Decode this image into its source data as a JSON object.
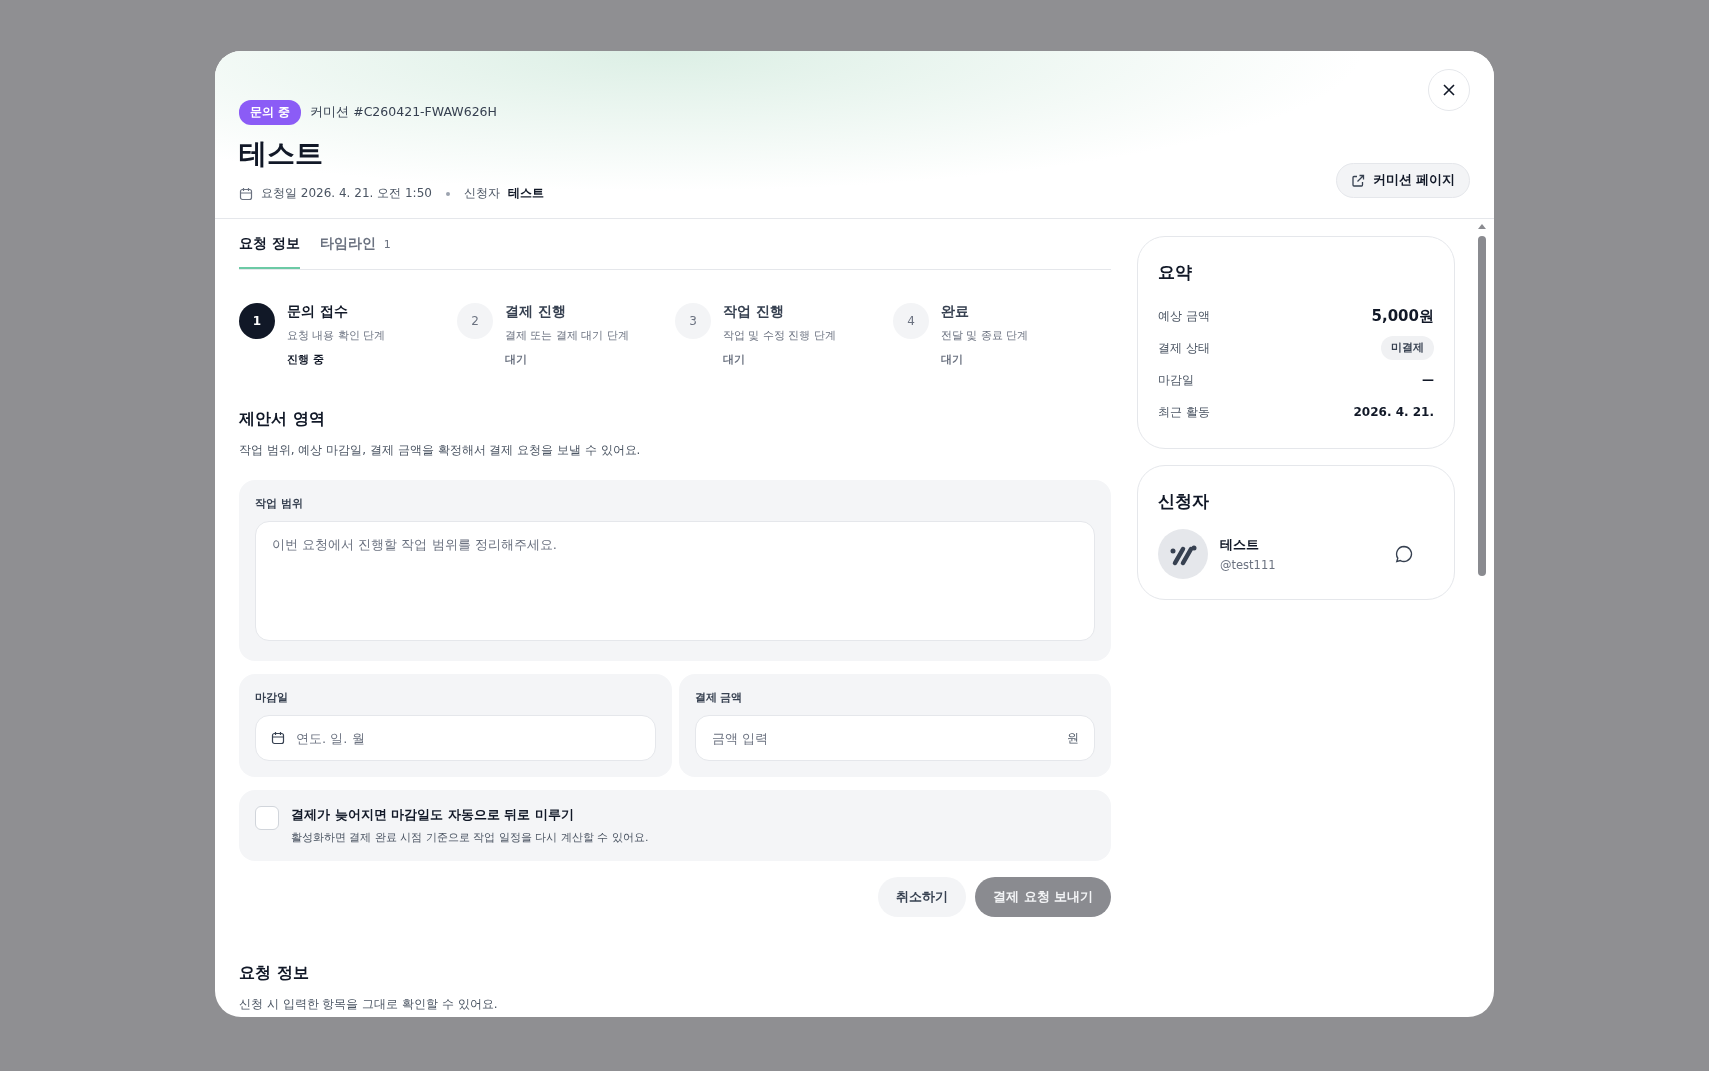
{
  "header": {
    "status_badge": "문의 중",
    "commission_id": "커미션 #C260421-FWAW626H",
    "title": "테스트",
    "requested": "요청일 2026. 4. 21. 오전 1:50",
    "requester_label": "신청자",
    "requester_name": "테스트",
    "page_button": "커미션 페이지"
  },
  "tabs": [
    {
      "label": "요청 정보",
      "selected": true
    },
    {
      "label": "타임라인",
      "count": "1",
      "selected": false
    }
  ],
  "steps": [
    {
      "number": "1",
      "title": "문의 접수",
      "description": "요청 내용 확인 단계",
      "status": "진행 중",
      "selected": true
    },
    {
      "number": "2",
      "title": "결제 진행",
      "description": "결제 또는 결제 대기 단계",
      "status": "대기",
      "selected": false
    },
    {
      "number": "3",
      "title": "작업 진행",
      "description": "작업 및 수정 진행 단계",
      "status": "대기",
      "selected": false
    },
    {
      "number": "4",
      "title": "완료",
      "description": "전달 및 종료 단계",
      "status": "대기",
      "selected": false
    }
  ],
  "proposal": {
    "title": "제안서 영역",
    "description": "작업 범위, 예상 마감일, 결제 금액을 확정해서 결제 요청을 보낼 수 있어요.",
    "scope": {
      "label": "작업 범위",
      "placeholder": "이번 요청에서 진행할 작업 범위를 정리해주세요."
    },
    "deadline": {
      "label": "마감일",
      "placeholder": "연도. 일. 월"
    },
    "amount": {
      "label": "결제 금액",
      "placeholder": "금액 입력",
      "unit": "원"
    },
    "auto_delay": {
      "label": "결제가 늦어지면 마감일도 자동으로 뒤로 미루기",
      "description": "활성화하면 결제 완료 시점 기준으로 작업 일정을 다시 계산할 수 있어요.",
      "checked": false
    },
    "cancel_button": "취소하기",
    "submit_button": {
      "label": "결제 요청 보내기",
      "disabled": true
    }
  },
  "request_info": {
    "title": "요청 정보",
    "description": "신청 시 입력한 항목을 그대로 확인할 수 있어요."
  },
  "summary": {
    "title": "요약",
    "rows": [
      {
        "label": "예상 금액",
        "value": "5,000원",
        "kind": "amount"
      },
      {
        "label": "결제 상태",
        "value": "미결제",
        "kind": "badge"
      },
      {
        "label": "마감일",
        "value": "—",
        "kind": "text"
      },
      {
        "label": "최근 활동",
        "value": "2026. 4. 21.",
        "kind": "text"
      }
    ]
  },
  "requester": {
    "title": "신청자",
    "name": "테스트",
    "handle": "@test111"
  }
}
